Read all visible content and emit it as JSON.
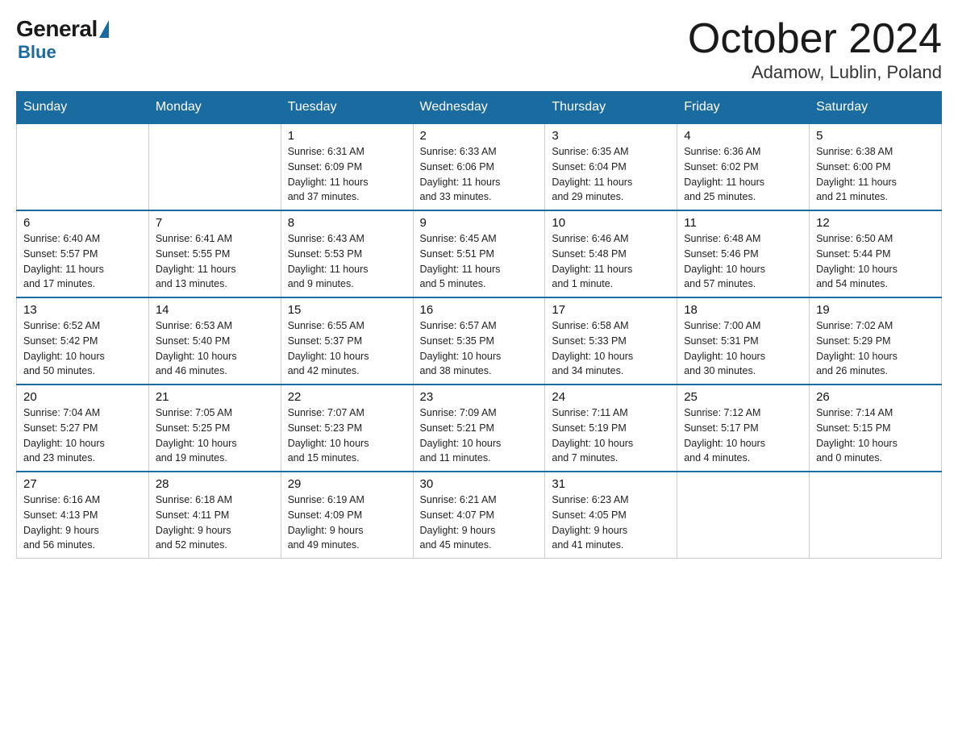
{
  "logo": {
    "general": "General",
    "blue": "Blue"
  },
  "title": {
    "month": "October 2024",
    "location": "Adamow, Lublin, Poland"
  },
  "weekdays": [
    "Sunday",
    "Monday",
    "Tuesday",
    "Wednesday",
    "Thursday",
    "Friday",
    "Saturday"
  ],
  "weeks": [
    [
      {
        "day": "",
        "info": ""
      },
      {
        "day": "",
        "info": ""
      },
      {
        "day": "1",
        "info": "Sunrise: 6:31 AM\nSunset: 6:09 PM\nDaylight: 11 hours\nand 37 minutes."
      },
      {
        "day": "2",
        "info": "Sunrise: 6:33 AM\nSunset: 6:06 PM\nDaylight: 11 hours\nand 33 minutes."
      },
      {
        "day": "3",
        "info": "Sunrise: 6:35 AM\nSunset: 6:04 PM\nDaylight: 11 hours\nand 29 minutes."
      },
      {
        "day": "4",
        "info": "Sunrise: 6:36 AM\nSunset: 6:02 PM\nDaylight: 11 hours\nand 25 minutes."
      },
      {
        "day": "5",
        "info": "Sunrise: 6:38 AM\nSunset: 6:00 PM\nDaylight: 11 hours\nand 21 minutes."
      }
    ],
    [
      {
        "day": "6",
        "info": "Sunrise: 6:40 AM\nSunset: 5:57 PM\nDaylight: 11 hours\nand 17 minutes."
      },
      {
        "day": "7",
        "info": "Sunrise: 6:41 AM\nSunset: 5:55 PM\nDaylight: 11 hours\nand 13 minutes."
      },
      {
        "day": "8",
        "info": "Sunrise: 6:43 AM\nSunset: 5:53 PM\nDaylight: 11 hours\nand 9 minutes."
      },
      {
        "day": "9",
        "info": "Sunrise: 6:45 AM\nSunset: 5:51 PM\nDaylight: 11 hours\nand 5 minutes."
      },
      {
        "day": "10",
        "info": "Sunrise: 6:46 AM\nSunset: 5:48 PM\nDaylight: 11 hours\nand 1 minute."
      },
      {
        "day": "11",
        "info": "Sunrise: 6:48 AM\nSunset: 5:46 PM\nDaylight: 10 hours\nand 57 minutes."
      },
      {
        "day": "12",
        "info": "Sunrise: 6:50 AM\nSunset: 5:44 PM\nDaylight: 10 hours\nand 54 minutes."
      }
    ],
    [
      {
        "day": "13",
        "info": "Sunrise: 6:52 AM\nSunset: 5:42 PM\nDaylight: 10 hours\nand 50 minutes."
      },
      {
        "day": "14",
        "info": "Sunrise: 6:53 AM\nSunset: 5:40 PM\nDaylight: 10 hours\nand 46 minutes."
      },
      {
        "day": "15",
        "info": "Sunrise: 6:55 AM\nSunset: 5:37 PM\nDaylight: 10 hours\nand 42 minutes."
      },
      {
        "day": "16",
        "info": "Sunrise: 6:57 AM\nSunset: 5:35 PM\nDaylight: 10 hours\nand 38 minutes."
      },
      {
        "day": "17",
        "info": "Sunrise: 6:58 AM\nSunset: 5:33 PM\nDaylight: 10 hours\nand 34 minutes."
      },
      {
        "day": "18",
        "info": "Sunrise: 7:00 AM\nSunset: 5:31 PM\nDaylight: 10 hours\nand 30 minutes."
      },
      {
        "day": "19",
        "info": "Sunrise: 7:02 AM\nSunset: 5:29 PM\nDaylight: 10 hours\nand 26 minutes."
      }
    ],
    [
      {
        "day": "20",
        "info": "Sunrise: 7:04 AM\nSunset: 5:27 PM\nDaylight: 10 hours\nand 23 minutes."
      },
      {
        "day": "21",
        "info": "Sunrise: 7:05 AM\nSunset: 5:25 PM\nDaylight: 10 hours\nand 19 minutes."
      },
      {
        "day": "22",
        "info": "Sunrise: 7:07 AM\nSunset: 5:23 PM\nDaylight: 10 hours\nand 15 minutes."
      },
      {
        "day": "23",
        "info": "Sunrise: 7:09 AM\nSunset: 5:21 PM\nDaylight: 10 hours\nand 11 minutes."
      },
      {
        "day": "24",
        "info": "Sunrise: 7:11 AM\nSunset: 5:19 PM\nDaylight: 10 hours\nand 7 minutes."
      },
      {
        "day": "25",
        "info": "Sunrise: 7:12 AM\nSunset: 5:17 PM\nDaylight: 10 hours\nand 4 minutes."
      },
      {
        "day": "26",
        "info": "Sunrise: 7:14 AM\nSunset: 5:15 PM\nDaylight: 10 hours\nand 0 minutes."
      }
    ],
    [
      {
        "day": "27",
        "info": "Sunrise: 6:16 AM\nSunset: 4:13 PM\nDaylight: 9 hours\nand 56 minutes."
      },
      {
        "day": "28",
        "info": "Sunrise: 6:18 AM\nSunset: 4:11 PM\nDaylight: 9 hours\nand 52 minutes."
      },
      {
        "day": "29",
        "info": "Sunrise: 6:19 AM\nSunset: 4:09 PM\nDaylight: 9 hours\nand 49 minutes."
      },
      {
        "day": "30",
        "info": "Sunrise: 6:21 AM\nSunset: 4:07 PM\nDaylight: 9 hours\nand 45 minutes."
      },
      {
        "day": "31",
        "info": "Sunrise: 6:23 AM\nSunset: 4:05 PM\nDaylight: 9 hours\nand 41 minutes."
      },
      {
        "day": "",
        "info": ""
      },
      {
        "day": "",
        "info": ""
      }
    ]
  ]
}
